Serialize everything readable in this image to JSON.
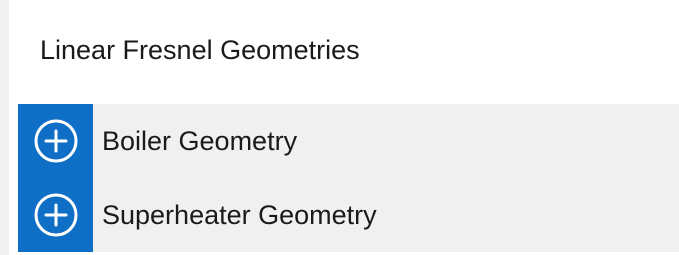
{
  "section": {
    "title": "Linear Fresnel Geometries"
  },
  "items": [
    {
      "label": "Boiler Geometry",
      "icon": "plus-circle-icon"
    },
    {
      "label": "Superheater Geometry",
      "icon": "plus-circle-icon"
    }
  ],
  "colors": {
    "accent": "#0F6FC6",
    "list_background": "#F0F0F0",
    "text": "#1A1A1A"
  }
}
